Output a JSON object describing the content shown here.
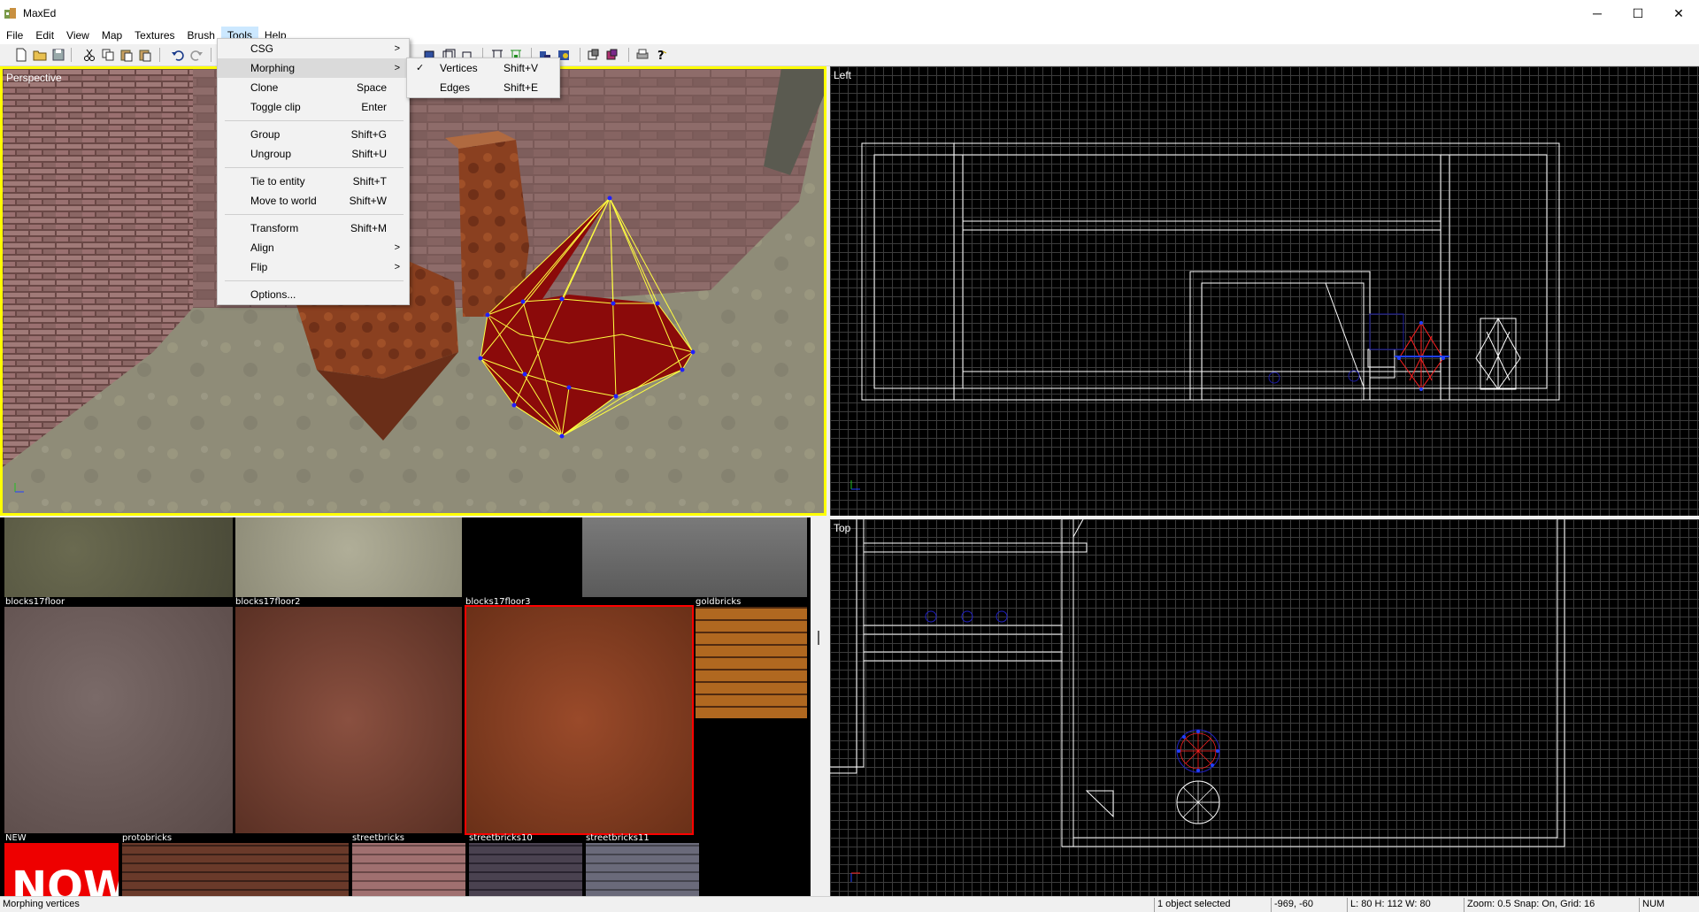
{
  "window": {
    "title": "MaxEd",
    "controls": [
      "─",
      "☐",
      "✕"
    ]
  },
  "menubar": [
    "File",
    "Edit",
    "View",
    "Map",
    "Textures",
    "Brush",
    "Tools",
    "Help"
  ],
  "tools_menu": {
    "items": [
      {
        "label": "CSG",
        "shortcut": "",
        "submenu": true
      },
      {
        "label": "Morphing",
        "shortcut": "",
        "submenu": true
      },
      {
        "label": "Clone",
        "shortcut": "Space",
        "submenu": false
      },
      {
        "label": "Toggle clip",
        "shortcut": "Enter",
        "submenu": false
      },
      {
        "label": "Group",
        "shortcut": "Shift+G",
        "submenu": false
      },
      {
        "label": "Ungroup",
        "shortcut": "Shift+U",
        "submenu": false
      },
      {
        "label": "Tie to entity",
        "shortcut": "Shift+T",
        "submenu": false
      },
      {
        "label": "Move to world",
        "shortcut": "Shift+W",
        "submenu": false
      },
      {
        "label": "Transform",
        "shortcut": "Shift+M",
        "submenu": false
      },
      {
        "label": "Align",
        "shortcut": "",
        "submenu": true
      },
      {
        "label": "Flip",
        "shortcut": "",
        "submenu": true
      },
      {
        "label": "Options...",
        "shortcut": "",
        "submenu": false
      }
    ]
  },
  "morphing_submenu": {
    "items": [
      {
        "label": "Vertices",
        "shortcut": "Shift+V",
        "checked": true
      },
      {
        "label": "Edges",
        "shortcut": "Shift+E",
        "checked": false
      }
    ]
  },
  "viewports": {
    "perspective": "Perspective",
    "left": "Left",
    "top": "Top"
  },
  "textures": {
    "row1": [
      "blocks17floor",
      "blocks17floor2",
      "blocks17floor3",
      "goldbricks"
    ],
    "row2": [
      "NEW",
      "protobricks",
      "streetbricks",
      "streetbricks10",
      "streetbricks11"
    ],
    "selected": "blocks17floor3",
    "new_tile_text": "NOW"
  },
  "statusbar": {
    "message": "Morphing vertices",
    "selection": "1 object selected",
    "coords": "-969, -60",
    "dims": "L: 80 H: 112 W: 80",
    "zoom_snap": "Zoom: 0.5 Snap: On, Grid: 16",
    "num": "NUM"
  },
  "colors": {
    "selected_viewport_border": "#ffff00",
    "selected_texture_border": "#ff0000",
    "brush_red": "#8b0a0a",
    "vertex_blue": "#0000ff"
  }
}
